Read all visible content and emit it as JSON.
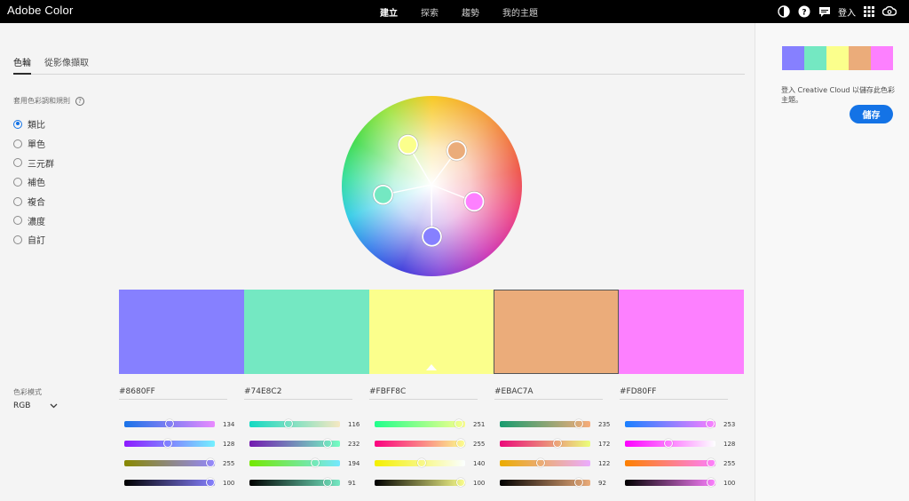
{
  "app": {
    "brand": "Adobe Color"
  },
  "nav": {
    "items": [
      "建立",
      "探索",
      "趨勢",
      "我的主題"
    ],
    "active_index": 0
  },
  "top_right": {
    "login": "登入",
    "icons": [
      "theme-toggle-icon",
      "help-icon",
      "chat-icon",
      "apps-grid-icon",
      "creative-cloud-icon"
    ]
  },
  "tabs": [
    {
      "label": "色輪",
      "active": true
    },
    {
      "label": "從影像擷取",
      "active": false
    }
  ],
  "harmony": {
    "label": "套用色彩調和規則",
    "rules": [
      "類比",
      "單色",
      "三元群",
      "補色",
      "複合",
      "濃度",
      "自訂"
    ],
    "selected_index": 0
  },
  "color_mode": {
    "label": "色彩模式",
    "value": "RGB"
  },
  "swatches": [
    {
      "hex": "#8680FF",
      "rgb": [
        134,
        128,
        255
      ],
      "brightness": 100
    },
    {
      "hex": "#74E8C2",
      "rgb": [
        116,
        232,
        194
      ],
      "brightness": 91
    },
    {
      "hex": "#FBFF8C",
      "rgb": [
        251,
        255,
        140
      ],
      "brightness": 100
    },
    {
      "hex": "#EBAC7A",
      "rgb": [
        235,
        172,
        122
      ],
      "brightness": 92
    },
    {
      "hex": "#FD80FF",
      "rgb": [
        253,
        128,
        255
      ],
      "brightness": 100
    }
  ],
  "selected_swatch_index": 2,
  "outlined_swatch_index": 3,
  "slider_gradients": [
    [
      [
        "#1a73e8",
        "#e98aff"
      ],
      [
        "#8d1aff",
        "#74f0ff"
      ],
      [
        "#888800",
        "#9488ff"
      ],
      [
        "#000000",
        "#8680ff"
      ]
    ],
    [
      [
        "#12d9c2",
        "#f6e8c2"
      ],
      [
        "#741ab0",
        "#74ffc2"
      ],
      [
        "#74e800",
        "#74e8ff"
      ],
      [
        "#000000",
        "#74e8c2"
      ]
    ],
    [
      [
        "#20ff8c",
        "#fbff8c"
      ],
      [
        "#fb0080",
        "#fbff8c"
      ],
      [
        "#f4ef00",
        "#fbffff"
      ],
      [
        "#000000",
        "#fbff8c"
      ]
    ],
    [
      [
        "#179c6f",
        "#f8ac7a"
      ],
      [
        "#eb0a7a",
        "#ebff7a"
      ],
      [
        "#ebac00",
        "#ebacff"
      ],
      [
        "#000000",
        "#ebac7a"
      ]
    ],
    [
      [
        "#1a80ff",
        "#fd80ff"
      ],
      [
        "#fd00ff",
        "#fdffff"
      ],
      [
        "#fd8000",
        "#fd80ff"
      ],
      [
        "#000000",
        "#fd80ff"
      ]
    ]
  ],
  "wheel_points": [
    {
      "name": "violet",
      "color": "#8680FF",
      "angle_deg": 180,
      "radius": 0.56
    },
    {
      "name": "mint",
      "color": "#74E8C2",
      "angle_deg": 260,
      "radius": 0.55
    },
    {
      "name": "yellow",
      "color": "#FBFF8C",
      "angle_deg": 330,
      "radius": 0.53
    },
    {
      "name": "tan",
      "color": "#EBAC7A",
      "angle_deg": 35,
      "radius": 0.48
    },
    {
      "name": "pink",
      "color": "#FD80FF",
      "angle_deg": 110,
      "radius": 0.5
    }
  ],
  "right_panel": {
    "message": "登入 Creative Cloud 以儲存此色彩主題。",
    "save_label": "儲存"
  }
}
